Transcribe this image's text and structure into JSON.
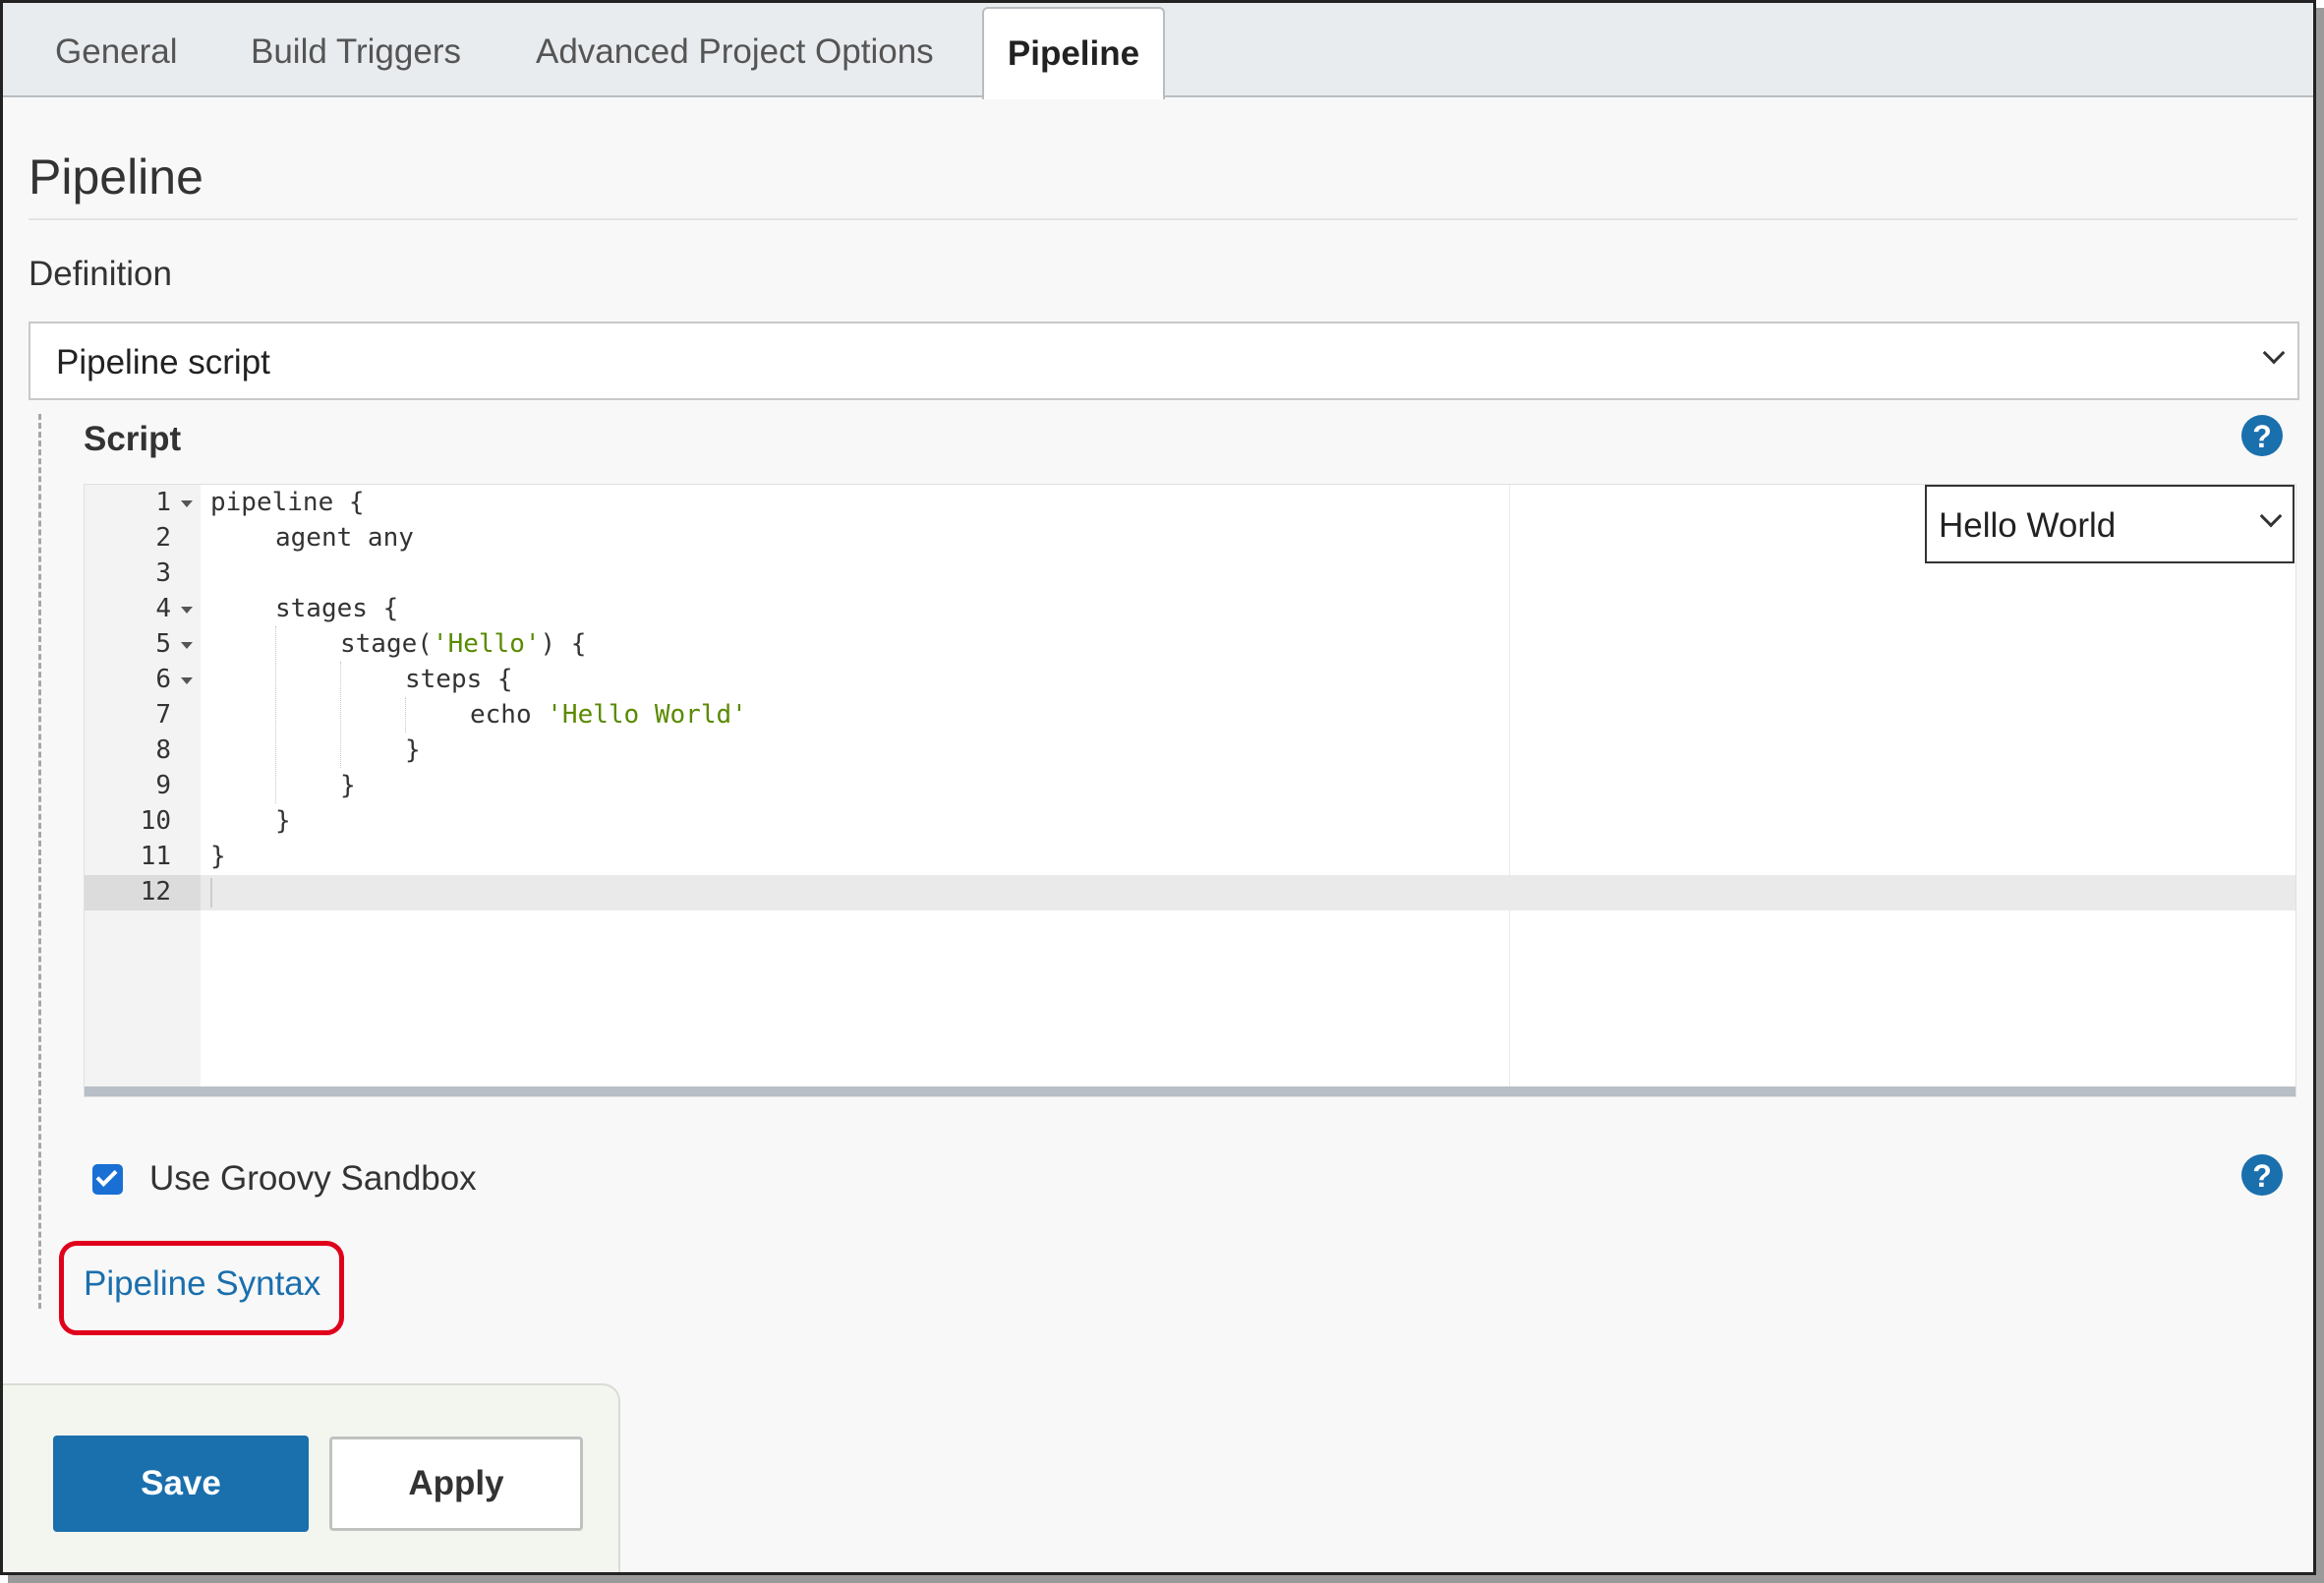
{
  "tabs": [
    {
      "label": "General"
    },
    {
      "label": "Build Triggers"
    },
    {
      "label": "Advanced Project Options"
    },
    {
      "label": "Pipeline",
      "active": true
    }
  ],
  "section": {
    "title": "Pipeline"
  },
  "definition": {
    "label": "Definition",
    "selected": "Pipeline script"
  },
  "script": {
    "label": "Script",
    "help_icon": "question-circle-icon",
    "sample_select": "Hello World",
    "line_numbers": [
      "1",
      "2",
      "3",
      "4",
      "5",
      "6",
      "7",
      "8",
      "9",
      "10",
      "11",
      "12"
    ],
    "code_lines": [
      "pipeline {",
      "agent any",
      "",
      "stages {",
      "stage(",
      "steps {",
      "echo ",
      "}",
      "}",
      "}",
      "}",
      ""
    ],
    "strings": {
      "hello": "'Hello'",
      "hello_world": "'Hello World'"
    },
    "stage_tail": ") {"
  },
  "sandbox": {
    "label": "Use Groovy Sandbox",
    "checked": true
  },
  "links": {
    "pipeline_syntax": "Pipeline Syntax"
  },
  "buttons": {
    "save": "Save",
    "apply": "Apply"
  },
  "colors": {
    "accent": "#1a6fad",
    "checkbox": "#1a6fd4",
    "highlight": "#e0001b",
    "string": "#5a8a00"
  }
}
